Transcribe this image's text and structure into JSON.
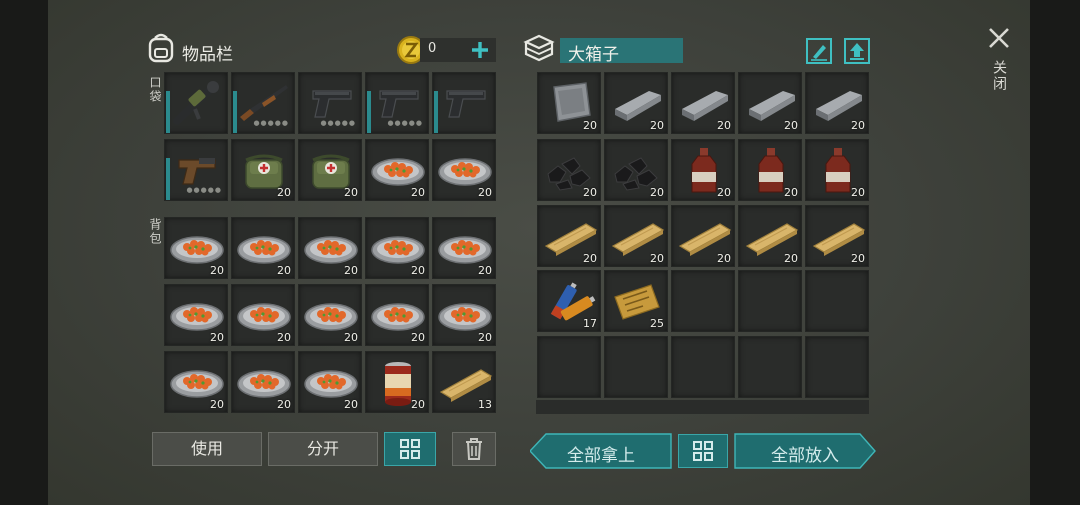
{
  "left": {
    "title": "物品栏",
    "coins": "0",
    "pocket_label": "口袋",
    "backpack_label": "背包",
    "pocket": [
      {
        "item": "rocket-launcher",
        "count": "",
        "bar": true,
        "dots": false
      },
      {
        "item": "shotgun",
        "count": "",
        "bar": true,
        "dots": true
      },
      {
        "item": "pistol",
        "count": "",
        "bar": false,
        "dots": true
      },
      {
        "item": "pistol",
        "count": "",
        "bar": true,
        "dots": true
      },
      {
        "item": "pistol",
        "count": "",
        "bar": true,
        "dots": false
      },
      {
        "item": "flare-gun",
        "count": "",
        "bar": true,
        "dots": true
      },
      {
        "item": "medkit-bag",
        "count": "20",
        "bar": false,
        "dots": false
      },
      {
        "item": "medkit-bag",
        "count": "20",
        "bar": false,
        "dots": false
      },
      {
        "item": "food-plate",
        "count": "20",
        "bar": false,
        "dots": false
      },
      {
        "item": "food-plate",
        "count": "20",
        "bar": false,
        "dots": false
      }
    ],
    "backpack": [
      {
        "item": "food-plate",
        "count": "20"
      },
      {
        "item": "food-plate",
        "count": "20"
      },
      {
        "item": "food-plate",
        "count": "20"
      },
      {
        "item": "food-plate",
        "count": "20"
      },
      {
        "item": "food-plate",
        "count": "20"
      },
      {
        "item": "food-plate",
        "count": "20"
      },
      {
        "item": "food-plate",
        "count": "20"
      },
      {
        "item": "food-plate",
        "count": "20"
      },
      {
        "item": "food-plate",
        "count": "20"
      },
      {
        "item": "food-plate",
        "count": "20"
      },
      {
        "item": "food-plate",
        "count": "20"
      },
      {
        "item": "food-plate",
        "count": "20"
      },
      {
        "item": "food-plate",
        "count": "20"
      },
      {
        "item": "canned-food",
        "count": "20"
      },
      {
        "item": "wood-plank",
        "count": "13"
      }
    ],
    "use_label": "使用",
    "split_label": "分开"
  },
  "right": {
    "title": "大箱子",
    "close_label": "关闭",
    "slots": [
      {
        "item": "metal-sheet",
        "count": "20"
      },
      {
        "item": "iron-ingot",
        "count": "20"
      },
      {
        "item": "iron-ingot",
        "count": "20"
      },
      {
        "item": "iron-ingot",
        "count": "20"
      },
      {
        "item": "iron-ingot",
        "count": "20"
      },
      {
        "item": "coal",
        "count": "20"
      },
      {
        "item": "coal",
        "count": "20"
      },
      {
        "item": "brown-bottle",
        "count": "20"
      },
      {
        "item": "brown-bottle",
        "count": "20"
      },
      {
        "item": "brown-bottle",
        "count": "20"
      },
      {
        "item": "wood-plank",
        "count": "20"
      },
      {
        "item": "wood-plank",
        "count": "20"
      },
      {
        "item": "wood-plank",
        "count": "20"
      },
      {
        "item": "wood-plank",
        "count": "20"
      },
      {
        "item": "wood-plank",
        "count": "20"
      },
      {
        "item": "batteries",
        "count": "17"
      },
      {
        "item": "coupon",
        "count": "25"
      },
      {
        "item": "",
        "count": ""
      },
      {
        "item": "",
        "count": ""
      },
      {
        "item": "",
        "count": ""
      },
      {
        "item": "",
        "count": ""
      },
      {
        "item": "",
        "count": ""
      },
      {
        "item": "",
        "count": ""
      },
      {
        "item": "",
        "count": ""
      },
      {
        "item": "",
        "count": ""
      }
    ],
    "take_all_label": "全部拿上",
    "put_all_label": "全部放入"
  },
  "colors": {
    "teal": "#2b8b8e",
    "accent": "#3fc0c2",
    "coin": "#d8b21e"
  }
}
